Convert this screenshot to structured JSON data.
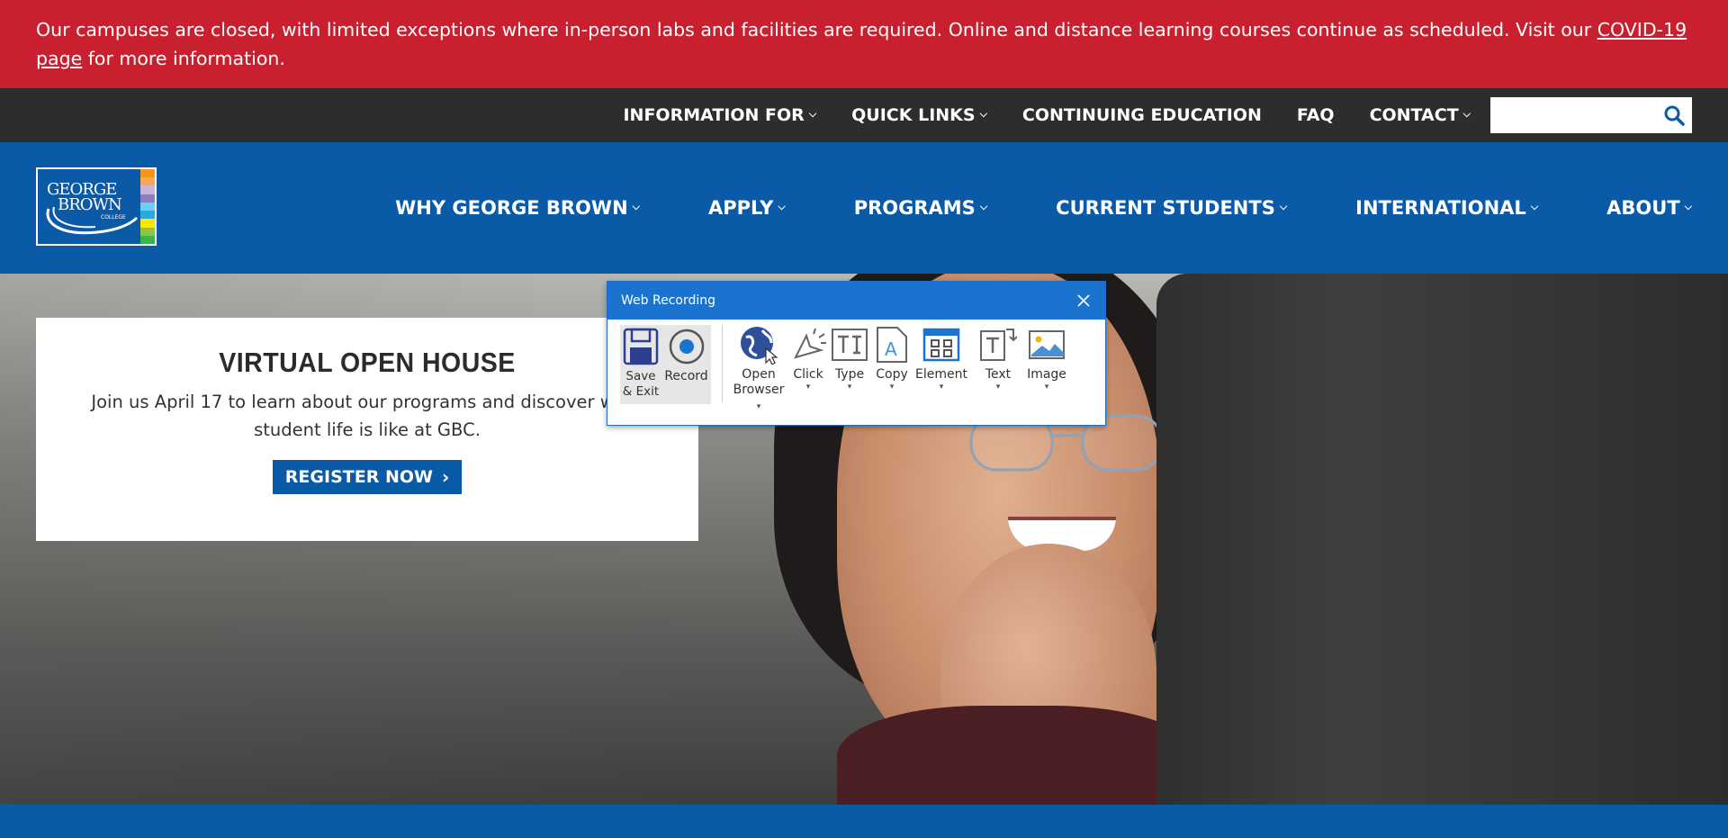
{
  "alert": {
    "text_before": "Our campuses are closed, with limited exceptions where in-person labs and facilities are required. Online and distance learning courses continue as scheduled. Visit our ",
    "link": "COVID-19 page",
    "text_after": " for more information."
  },
  "utility_nav": {
    "items": [
      {
        "label": "INFORMATION FOR",
        "dropdown": true
      },
      {
        "label": "QUICK LINKS",
        "dropdown": true
      },
      {
        "label": "CONTINUING EDUCATION",
        "dropdown": false
      },
      {
        "label": "FAQ",
        "dropdown": false
      },
      {
        "label": "CONTACT",
        "dropdown": true
      }
    ],
    "search": {
      "value": "",
      "placeholder": "",
      "icon": "search-icon"
    }
  },
  "logo": {
    "line1": "GEORGE",
    "line2": "BROWN",
    "line3": "COLLEGE",
    "stripe_colors": [
      "#f7941d",
      "#f9a65a",
      "#c9b3d9",
      "#8b7fc1",
      "#6dcff6",
      "#2aa9e0",
      "#ffe600",
      "#8dc63f",
      "#39b54a"
    ]
  },
  "main_nav": {
    "items": [
      "WHY GEORGE BROWN",
      "APPLY",
      "PROGRAMS",
      "CURRENT STUDENTS",
      "INTERNATIONAL",
      "ABOUT"
    ]
  },
  "promo": {
    "title": "VIRTUAL OPEN HOUSE",
    "text": "Join us April 17 to learn about our programs and discover what student life is like at GBC.",
    "button": "REGISTER NOW"
  },
  "recorder": {
    "title": "Web Recording",
    "tools": {
      "save": "Save & Exit",
      "record": "Record",
      "open_browser_1": "Open",
      "open_browser_2": "Browser",
      "click": "Click",
      "type": "Type",
      "copy": "Copy",
      "element": "Element",
      "text": "Text",
      "image": "Image"
    }
  },
  "colors": {
    "alert_red": "#c8202f",
    "utility_dark": "#2d2d2d",
    "brand_blue": "#0b5aa8",
    "recorder_blue": "#1b73d0"
  }
}
